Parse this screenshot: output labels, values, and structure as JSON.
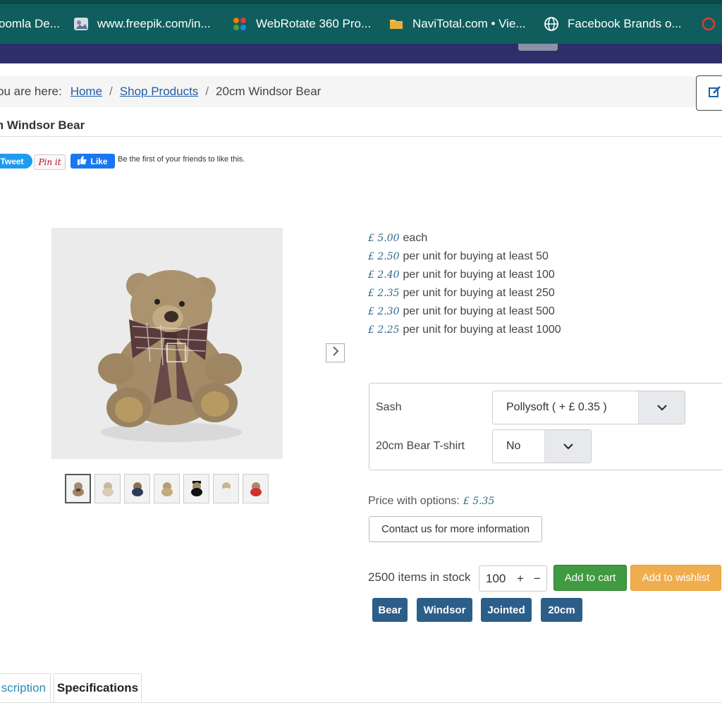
{
  "bookmarks": [
    {
      "label": "oomla De...",
      "icon": "joomla-icon"
    },
    {
      "label": "www.freepik.com/in...",
      "icon": "freepik-icon"
    },
    {
      "label": "WebRotate 360 Pro...",
      "icon": "webrotate-icon"
    },
    {
      "label": "NaviTotal.com • Vie...",
      "icon": "folder-icon"
    },
    {
      "label": "Facebook  Brands o...",
      "icon": "globe-icon"
    }
  ],
  "breadcrumb": {
    "prefix": "ou are here:",
    "items": [
      "Home",
      "Shop Products",
      "20cm Windsor Bear"
    ]
  },
  "product": {
    "title": "m Windsor Bear"
  },
  "social": {
    "tweet": "Tweet",
    "pin": "Pin it",
    "like": "Like",
    "like_text": "Be the first of your friends to like this."
  },
  "gallery": {
    "thumbnail_count": 7,
    "active_index": 0
  },
  "prices": [
    {
      "value": "£ 5.00",
      "text": "each"
    },
    {
      "value": "£ 2.50",
      "text": "per unit for buying at least 50"
    },
    {
      "value": "£ 2.40",
      "text": "per unit for buying at least 100"
    },
    {
      "value": "£ 2.35",
      "text": "per unit for buying at least 250"
    },
    {
      "value": "£ 2.30",
      "text": "per unit for buying at least 500"
    },
    {
      "value": "£ 2.25",
      "text": "per unit for buying at least 1000"
    }
  ],
  "options": [
    {
      "label": "Sash",
      "value": "Pollysoft ( + £ 0.35 )"
    },
    {
      "label": "20cm Bear T-shirt",
      "value": "No"
    }
  ],
  "price_with_options": {
    "label": "Price with options:",
    "value": "£ 5.35"
  },
  "contact_button": "Contact us for more information",
  "stock": {
    "text": "2500 items in stock",
    "quantity": "100",
    "plus": "+",
    "minus": "−"
  },
  "buttons": {
    "add_to_cart": "Add to cart",
    "add_to_wishlist": "Add to wishlist"
  },
  "tags": [
    "Bear",
    "Windsor",
    "Jointed",
    "20cm"
  ],
  "tabs": [
    "scription",
    "Specifications"
  ],
  "colors": {
    "bookmarks_bar": "#0f5e5d",
    "nav_strip": "#2d2f6b",
    "link": "#1f5fa8",
    "price": "#2e6a8a",
    "add_to_cart": "#3f9b3f",
    "add_to_wishlist": "#f0ad4e",
    "tag": "#2c5e8a",
    "active_tab": "#2a8ab8"
  }
}
